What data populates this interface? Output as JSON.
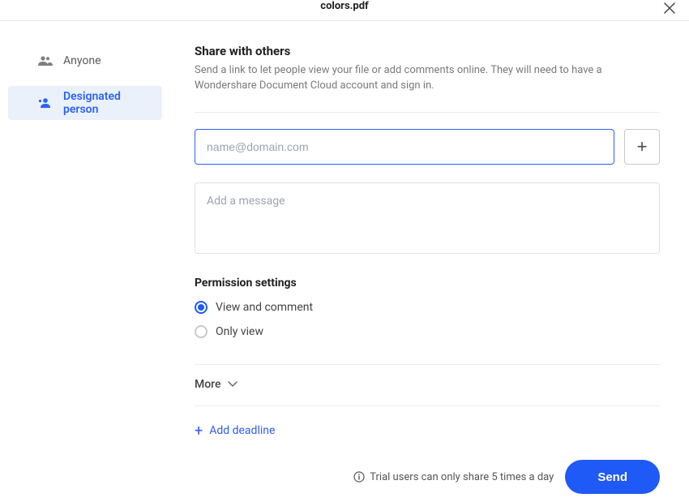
{
  "header": {
    "title": "colors.pdf"
  },
  "sidebar": {
    "items": [
      {
        "label": "Anyone",
        "active": false
      },
      {
        "label": "Designated person",
        "active": true
      }
    ]
  },
  "share": {
    "title": "Share with others",
    "description": "Send a link to let people view your file or add comments online. They will need to have a Wondershare Document Cloud account and sign in.",
    "email_placeholder": "name@domain.com",
    "email_value": "",
    "message_placeholder": "Add a message",
    "message_value": ""
  },
  "permissions": {
    "title": "Permission settings",
    "options": [
      {
        "label": "View and comment",
        "selected": true
      },
      {
        "label": "Only view",
        "selected": false
      }
    ]
  },
  "more": {
    "label": "More"
  },
  "deadline": {
    "label": "Add deadline"
  },
  "footer": {
    "trial_note": "Trial users can only share 5 times a day",
    "send_label": "Send"
  }
}
